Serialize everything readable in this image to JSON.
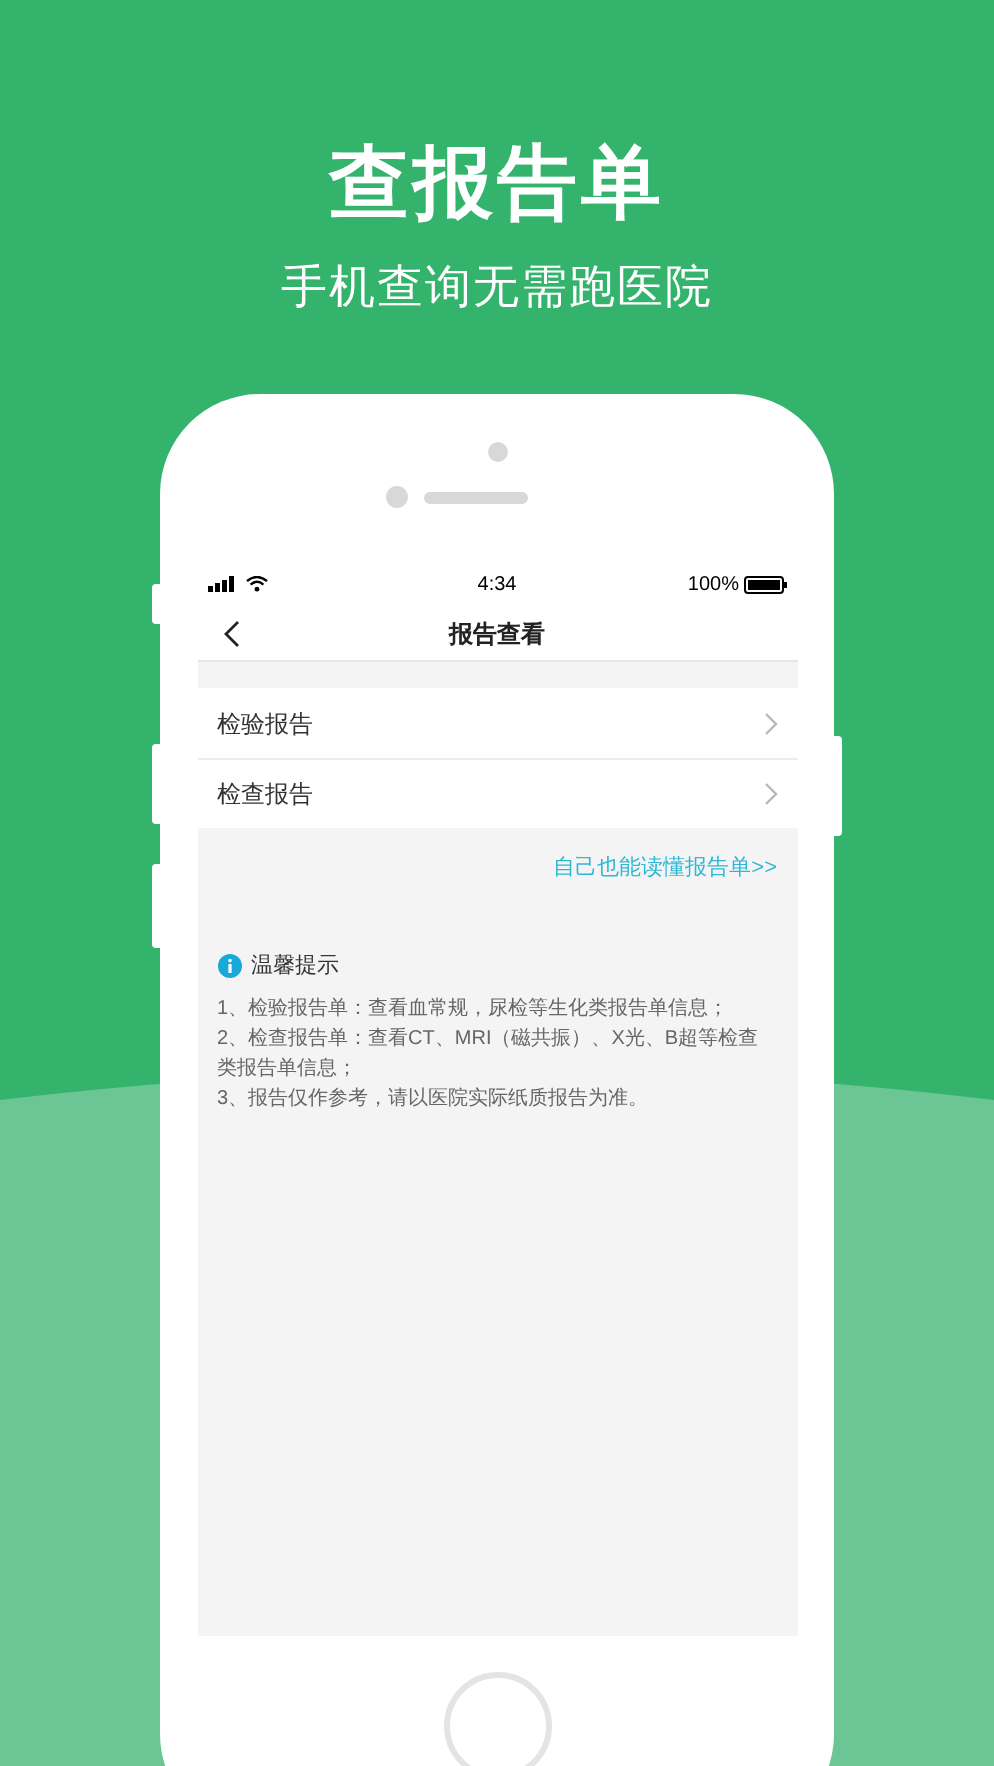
{
  "hero": {
    "title": "查报告单",
    "subtitle": "手机查询无需跑医院"
  },
  "status_bar": {
    "time": "4:34",
    "battery": "100%"
  },
  "nav": {
    "title": "报告查看"
  },
  "menu": [
    {
      "label": "检验报告"
    },
    {
      "label": "检查报告"
    }
  ],
  "link": "自己也能读懂报告单>>",
  "tips": {
    "title": "温馨提示",
    "lines": [
      "1、检验报告单：查看血常规，尿检等生化类报告单信息；",
      "2、检查报告单：查看CT、MRI（磁共振）、X光、B超等检查类报告单信息；",
      "3、报告仅作参考，请以医院实际纸质报告为准。"
    ]
  }
}
